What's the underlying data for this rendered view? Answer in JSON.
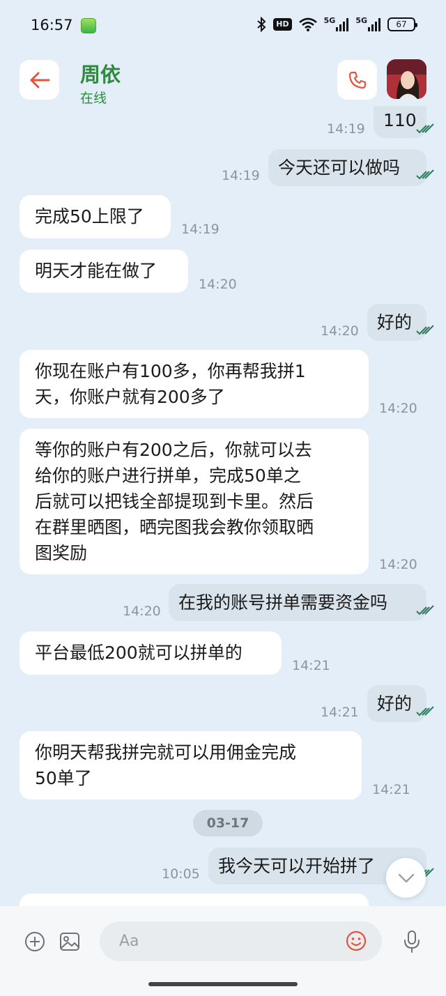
{
  "status_bar": {
    "time": "16:57",
    "hd_label": "HD",
    "signal1_label": "5G",
    "signal2_label": "5G",
    "battery": "67"
  },
  "header": {
    "contact_name": "周依",
    "contact_status": "在线"
  },
  "messages": [
    {
      "dir": "out",
      "text": "110",
      "time": "14:19"
    },
    {
      "dir": "out",
      "text": "今天还可以做吗",
      "time": "14:19"
    },
    {
      "dir": "in",
      "text": "完成50上限了",
      "time": "14:19"
    },
    {
      "dir": "in",
      "text": "明天才能在做了",
      "time": "14:20"
    },
    {
      "dir": "out",
      "text": "好的",
      "time": "14:20"
    },
    {
      "dir": "in",
      "lines": [
        "你现在账户有100多，你再帮我拼1",
        "天，你账户就有200多了"
      ],
      "time": "14:20"
    },
    {
      "dir": "in",
      "lines": [
        "等你的账户有200之后，你就可以去",
        "给你的账户进行拼单，完成50单之",
        "后就可以把钱全部提现到卡里。然后",
        "在群里晒图，晒完图我会教你领取晒",
        "图奖励"
      ],
      "time": "14:20"
    },
    {
      "dir": "out",
      "text": "在我的账号拼单需要资金吗",
      "time": "14:20"
    },
    {
      "dir": "in",
      "text": "平台最低200就可以拼单的",
      "time": "14:21"
    },
    {
      "dir": "out",
      "text": "好的",
      "time": "14:21"
    },
    {
      "dir": "in",
      "lines": [
        "你明天帮我拼完就可以用佣金完成",
        "50单了"
      ],
      "time": "14:21"
    },
    {
      "dir": "out",
      "text": "我今天可以开始拼了",
      "time": "10:05"
    }
  ],
  "date_divider": "03-17",
  "input": {
    "placeholder": "Aa"
  },
  "colors": {
    "background": "#e3eef8",
    "accent_green": "#2e8b3d",
    "accent_red": "#e2553a",
    "outgoing_bubble": "#d8e3eb",
    "incoming_bubble": "#ffffff",
    "tick_color": "#2a7a5a"
  },
  "icons": [
    "back-arrow-icon",
    "phone-icon",
    "add-icon",
    "image-icon",
    "emoji-icon",
    "microphone-icon",
    "chevron-down-icon",
    "bluetooth-icon",
    "wifi-icon"
  ]
}
